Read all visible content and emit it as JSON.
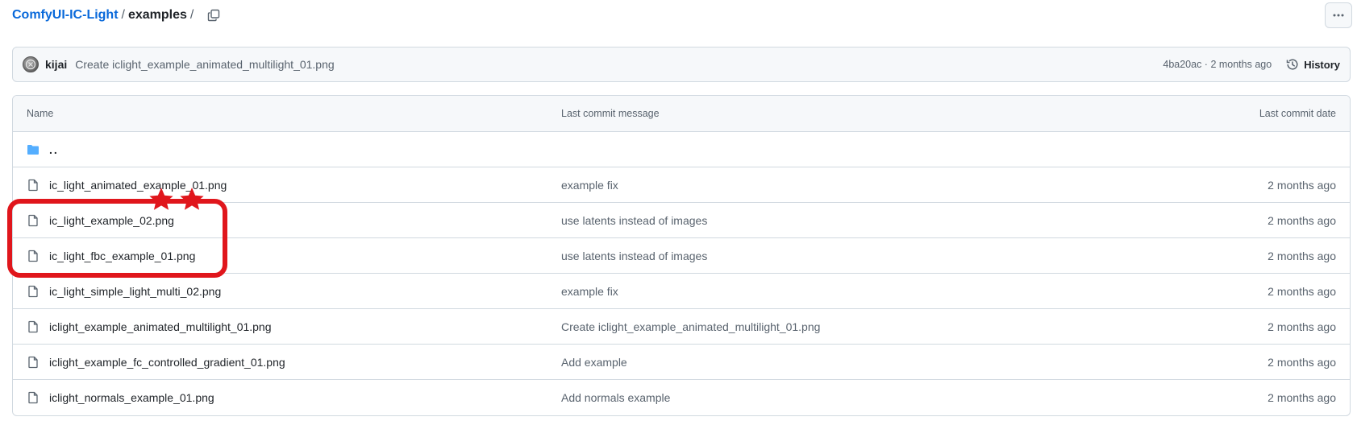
{
  "breadcrumb": {
    "repo": "ComfyUI-IC-Light",
    "separator": "/",
    "folder": "examples"
  },
  "commit": {
    "author": "kijai",
    "message": "Create iclight_example_animated_multilight_01.png",
    "meta": "4ba20ac · 2 months ago",
    "history_label": "History"
  },
  "table": {
    "headers": {
      "name": "Name",
      "message": "Last commit message",
      "date": "Last commit date"
    },
    "parent": "..",
    "rows": [
      {
        "name": "ic_light_animated_example_01.png",
        "message": "example fix",
        "date": "2 months ago"
      },
      {
        "name": "ic_light_example_02.png",
        "message": "use latents instead of images",
        "date": "2 months ago"
      },
      {
        "name": "ic_light_fbc_example_01.png",
        "message": "use latents instead of images",
        "date": "2 months ago"
      },
      {
        "name": "ic_light_simple_light_multi_02.png",
        "message": "example fix",
        "date": "2 months ago"
      },
      {
        "name": "iclight_example_animated_multilight_01.png",
        "message": "Create iclight_example_animated_multilight_01.png",
        "date": "2 months ago"
      },
      {
        "name": "iclight_example_fc_controlled_gradient_01.png",
        "message": "Add example",
        "date": "2 months ago"
      },
      {
        "name": "iclight_normals_example_01.png",
        "message": "Add normals example",
        "date": "2 months ago"
      }
    ]
  },
  "colors": {
    "accent_link": "#0969da",
    "annotation_red": "#e0161c",
    "folder_blue": "#54aeff"
  }
}
